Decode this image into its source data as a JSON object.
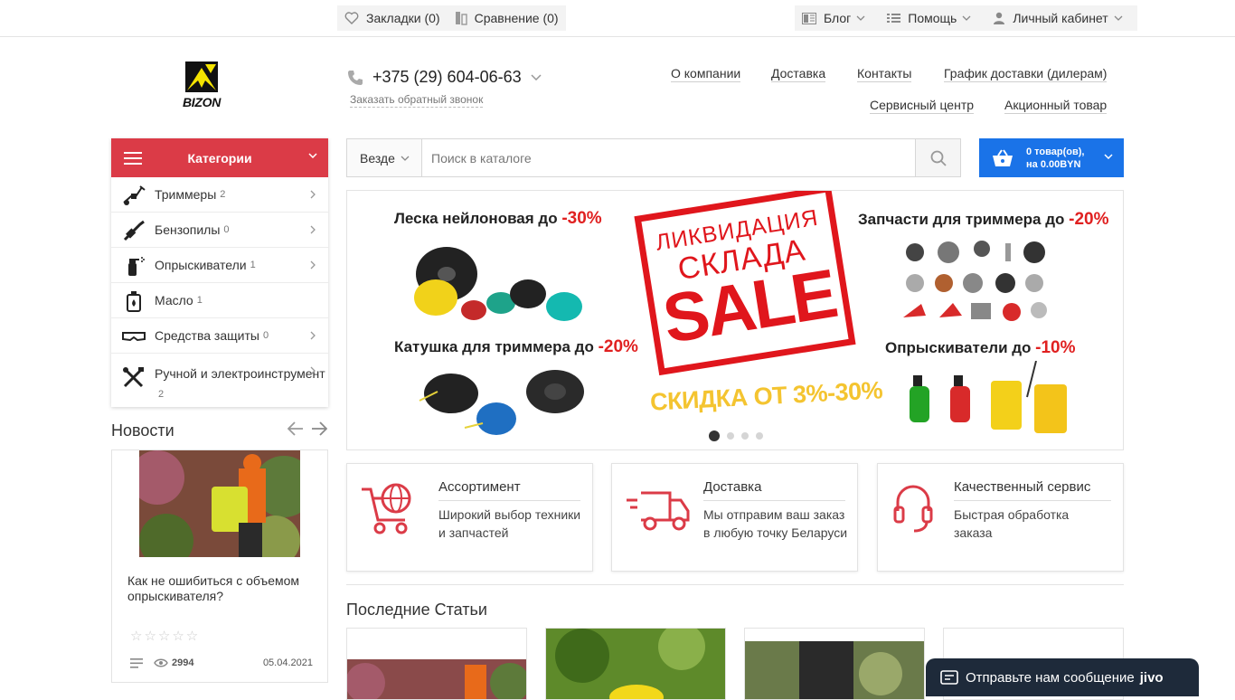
{
  "topbar": {
    "bookmarks": "Закладки (0)",
    "compare": "Сравнение (0)",
    "blog": "Блог",
    "help": "Помощь",
    "account": "Личный кабинет"
  },
  "header": {
    "logo_text": "BIZON",
    "phone": "+375 (29) 604-06-63",
    "callback": "Заказать обратный звонок",
    "nav": [
      "О компании",
      "Доставка",
      "Контакты",
      "График доставки (дилерам)",
      "Сервисный центр",
      "Акционный товар"
    ]
  },
  "categories": {
    "title": "Категории",
    "items": [
      {
        "label": "Триммеры",
        "count": "2",
        "icon": "trimmer-icon"
      },
      {
        "label": "Бензопилы",
        "count": "0",
        "icon": "chainsaw-icon"
      },
      {
        "label": "Опрыскиватели",
        "count": "1",
        "icon": "sprayer-icon"
      },
      {
        "label": "Масло",
        "count": "1",
        "icon": "oil-can-icon"
      },
      {
        "label": "Средства защиты",
        "count": "0",
        "icon": "goggles-icon"
      },
      {
        "label": "Ручной и электроинструмент",
        "count": "2",
        "icon": "tools-icon"
      }
    ]
  },
  "search": {
    "scope": "Везде",
    "placeholder": "Поиск в каталоге"
  },
  "cart": {
    "line1": "0 товар(ов),",
    "line2": "на 0.00BYN"
  },
  "banner": {
    "line_a": "Леска нейлоновая до ",
    "line_a_pct": "-30%",
    "line_b": "Катушка для триммера до ",
    "line_b_pct": "-20%",
    "line_c": "Запчасти для триммера до ",
    "line_c_pct": "-20%",
    "line_d": "Опрыскиватели до ",
    "line_d_pct": "-10%",
    "sale_1": "ЛИКВИДАЦИЯ",
    "sale_2": "СКЛАДА",
    "sale_3": "SALE",
    "discount": "СКИДКА ОТ 3%-30%",
    "slides": 4,
    "active_slide": 1
  },
  "news": {
    "title": "Новости",
    "card": {
      "text": "Как не ошибиться с объемом опрыскивателя?",
      "stars": "☆☆☆☆☆",
      "views": "2994",
      "date": "05.04.2021"
    }
  },
  "features": [
    {
      "title": "Ассортимент",
      "desc": "Широкий выбор техники и запчастей",
      "icon": "cart-globe-icon"
    },
    {
      "title": "Доставка",
      "desc": "Мы отправим ваш заказ в любую точку Беларуси",
      "icon": "truck-icon"
    },
    {
      "title": "Качественный сервис",
      "desc": "Быстрая обработка заказа",
      "icon": "headset-icon"
    }
  ],
  "articles": {
    "title": "Последние Статьи"
  },
  "jivo": {
    "label": "Отправьте нам сообщение",
    "brand": "jivo"
  },
  "colors": {
    "accent_red": "#db3b47",
    "cart_blue": "#1a73e8",
    "sale_red": "#e0161c",
    "discount_yellow": "#f4c430"
  }
}
